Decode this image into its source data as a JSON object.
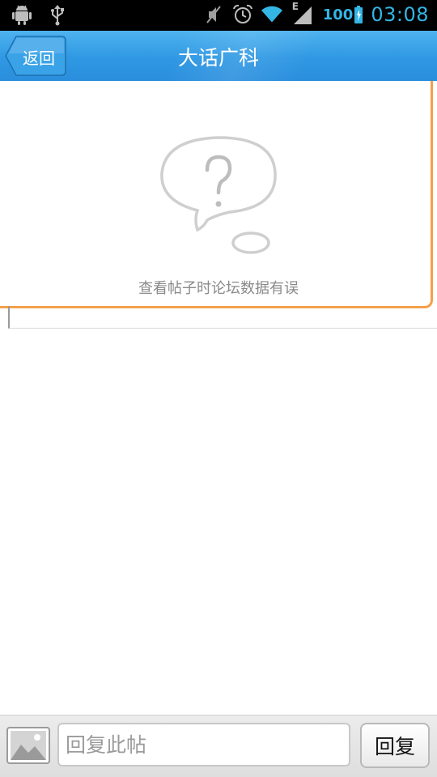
{
  "status_bar": {
    "left_icons": [
      "android-debug-icon",
      "usb-icon"
    ],
    "right_icons": [
      "mute-icon",
      "alarm-icon",
      "wifi-icon",
      "signal-icon"
    ],
    "network_type": "E",
    "battery": "100",
    "time": "03:08"
  },
  "header": {
    "back_label": "返回",
    "title": "大话广科"
  },
  "error": {
    "message": "查看帖子时论坛数据有误"
  },
  "reply": {
    "placeholder": "回复此帖",
    "value": "",
    "button_label": "回复"
  },
  "colors": {
    "accent": "#33b5e5",
    "header": "#2f98e3",
    "card_border": "#f4a04a"
  }
}
